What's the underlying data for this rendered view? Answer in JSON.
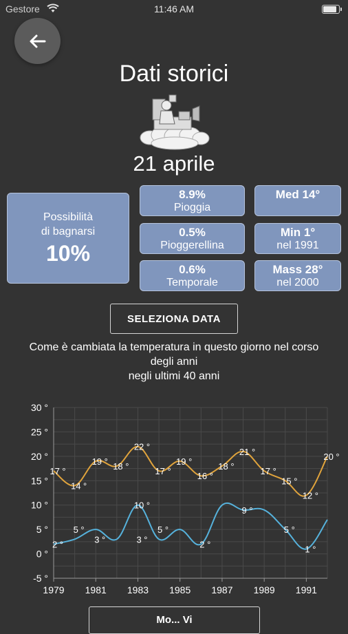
{
  "status_bar": {
    "carrier": "Gestore",
    "time": "11:46 AM",
    "battery_level": 0.95
  },
  "header": {
    "title": "Dati storici",
    "date": "21 aprile"
  },
  "bathing": {
    "label_line1": "Possibilità",
    "label_line2": "di bagnarsi",
    "value": "10%"
  },
  "precipitation": [
    {
      "value": "8.9%",
      "label": "Pioggia"
    },
    {
      "value": "0.5%",
      "label": "Pioggerellina"
    },
    {
      "value": "0.6%",
      "label": "Temporale"
    }
  ],
  "temperatures": [
    {
      "value": "Med 14°",
      "label": ""
    },
    {
      "value": "Min 1°",
      "label": "nel 1991"
    },
    {
      "value": "Mass 28°",
      "label": "nel 2000"
    }
  ],
  "select_date_label": "SELEZIONA DATA",
  "caption": {
    "line1": "Come è cambiata la temperatura in questo giorno nel corso",
    "line2": "degli anni",
    "line3": "negli ultimi 40 anni"
  },
  "bottom_button_label": "Mo... Vi",
  "colors": {
    "background": "#333333",
    "card": "#8096bd",
    "max_line": "#e1a43c",
    "min_line": "#56b2dc"
  },
  "chart_data": {
    "type": "line",
    "x": [
      1979,
      1980,
      1981,
      1982,
      1983,
      1984,
      1985,
      1986,
      1987,
      1988,
      1989,
      1990,
      1991,
      1992
    ],
    "xticks": [
      "1979",
      "1981",
      "1983",
      "1985",
      "1987",
      "1989",
      "1991"
    ],
    "yticks": [
      "30 °",
      "25 °",
      "20 °",
      "15 °",
      "10 °",
      "5 °",
      "0 °",
      "-5 °"
    ],
    "ylim": [
      -5,
      30
    ],
    "grid": true,
    "series": [
      {
        "key": "max",
        "values": [
          17,
          14,
          19,
          18,
          22,
          17,
          19,
          16,
          18,
          21,
          17,
          15,
          12,
          20
        ]
      },
      {
        "key": "min",
        "values": [
          2,
          3,
          5,
          3,
          10,
          3,
          5,
          2,
          10,
          9,
          9,
          5,
          1,
          7
        ]
      }
    ],
    "labels": [
      {
        "x": 1979,
        "y": 17,
        "text": "17 °"
      },
      {
        "x": 1980,
        "y": 14,
        "text": "14 °"
      },
      {
        "x": 1981,
        "y": 19,
        "text": "19 °"
      },
      {
        "x": 1982,
        "y": 18,
        "text": "18 °"
      },
      {
        "x": 1983,
        "y": 22,
        "text": "22 °"
      },
      {
        "x": 1983,
        "y": 10,
        "text": "10 °"
      },
      {
        "x": 1984,
        "y": 17,
        "text": "17 °"
      },
      {
        "x": 1985,
        "y": 19,
        "text": "19 °"
      },
      {
        "x": 1986,
        "y": 16,
        "text": "16 °"
      },
      {
        "x": 1987,
        "y": 18,
        "text": "18 °"
      },
      {
        "x": 1988,
        "y": 21,
        "text": "21 °"
      },
      {
        "x": 1988,
        "y": 9,
        "text": "9 °"
      },
      {
        "x": 1989,
        "y": 17,
        "text": "17 °"
      },
      {
        "x": 1990,
        "y": 15,
        "text": "15 °"
      },
      {
        "x": 1992,
        "y": 20,
        "text": "20 °"
      },
      {
        "x": 1980,
        "y": 5,
        "text": "5 °"
      },
      {
        "x": 1984,
        "y": 5,
        "text": "5 °"
      },
      {
        "x": 1991,
        "y": 12,
        "text": "12 °"
      },
      {
        "x": 1979,
        "y": 2,
        "text": "2 °"
      },
      {
        "x": 1981,
        "y": 3,
        "text": "3 °"
      },
      {
        "x": 1983,
        "y": 3,
        "text": "3 °"
      },
      {
        "x": 1986,
        "y": 2,
        "text": "2 °"
      },
      {
        "x": 1990,
        "y": 5,
        "text": "5 °"
      },
      {
        "x": 1991,
        "y": 1,
        "text": "1 °"
      }
    ]
  }
}
